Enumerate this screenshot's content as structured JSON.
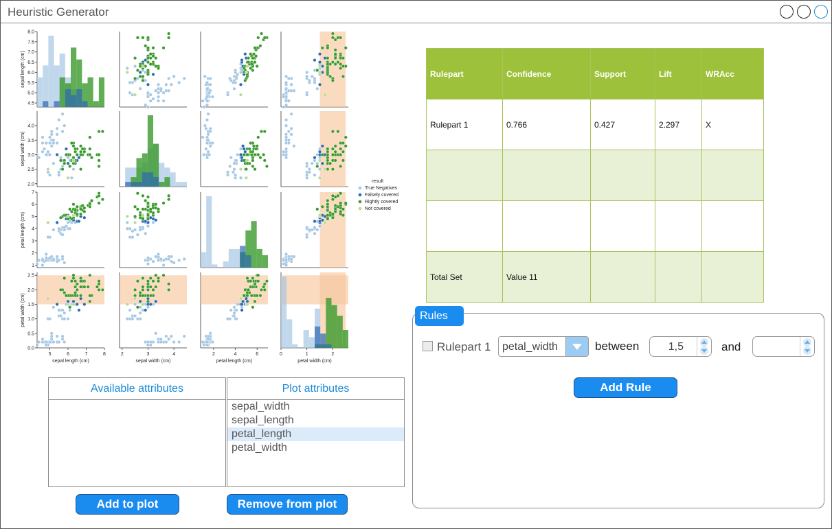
{
  "window": {
    "title": "Heuristic Generator"
  },
  "chart_data": {
    "type": "scatter",
    "subtype": "pairplot",
    "variables": [
      "sepal length (cm)",
      "sepal width (cm)",
      "petal length (cm)",
      "petal width (cm)"
    ],
    "axis_ranges": {
      "sepal length (cm)": [
        4.3,
        8.0
      ],
      "sepal width (cm)": [
        1.9,
        4.5
      ],
      "petal length (cm)": [
        0.8,
        7.0
      ],
      "petal width (cm)": [
        0.0,
        2.6
      ]
    },
    "y_ticks": [
      [
        "4.5",
        "5.0",
        "5.5",
        "6.0",
        "6.5",
        "7.0",
        "7.5",
        "8.0"
      ],
      [
        "2.0",
        "2.5",
        "3.0",
        "3.5",
        "4.0"
      ],
      [
        "1",
        "2",
        "3",
        "4",
        "5",
        "6",
        "7"
      ],
      [
        "0.0",
        "0.5",
        "1.0",
        "1.5",
        "2.0",
        "2.5"
      ]
    ],
    "x_ticks": [
      [
        "5",
        "6",
        "7",
        "8"
      ],
      [
        "2",
        "3",
        "4"
      ],
      [
        "2",
        "4",
        "6"
      ],
      [
        "0",
        "1",
        "2"
      ]
    ],
    "legend": {
      "title": "result",
      "placement": "right",
      "entries": [
        {
          "name": "True Negatives",
          "color": "#a6c8e4"
        },
        {
          "name": "Falsely covered",
          "color": "#2d6ab3"
        },
        {
          "name": "Rightly covered",
          "color": "#3a9a2c"
        },
        {
          "name": "Not covered",
          "color": "#b9dc8e"
        }
      ]
    },
    "highlight": {
      "variable": "petal width (cm)",
      "range": [
        1.5,
        2.5
      ],
      "color": "#f8c89e"
    },
    "series": [
      {
        "name": "True Negatives",
        "points": [
          [
            4.9,
            3.0,
            1.4,
            0.2
          ],
          [
            5.1,
            3.5,
            1.4,
            0.2
          ],
          [
            4.7,
            3.2,
            1.3,
            0.2
          ],
          [
            4.6,
            3.1,
            1.5,
            0.2
          ],
          [
            5.0,
            3.6,
            1.4,
            0.2
          ],
          [
            5.4,
            3.9,
            1.7,
            0.4
          ],
          [
            4.6,
            3.4,
            1.4,
            0.3
          ],
          [
            5.0,
            3.4,
            1.5,
            0.2
          ],
          [
            4.4,
            2.9,
            1.4,
            0.2
          ],
          [
            4.9,
            3.1,
            1.5,
            0.1
          ],
          [
            5.4,
            3.7,
            1.5,
            0.2
          ],
          [
            4.8,
            3.4,
            1.6,
            0.2
          ],
          [
            4.8,
            3.0,
            1.4,
            0.1
          ],
          [
            4.3,
            3.0,
            1.1,
            0.1
          ],
          [
            5.8,
            4.0,
            1.2,
            0.2
          ],
          [
            5.7,
            4.4,
            1.5,
            0.4
          ],
          [
            5.4,
            3.9,
            1.3,
            0.4
          ],
          [
            5.1,
            3.5,
            1.4,
            0.3
          ],
          [
            5.7,
            3.8,
            1.7,
            0.3
          ],
          [
            5.1,
            3.8,
            1.5,
            0.3
          ],
          [
            5.4,
            3.4,
            1.7,
            0.2
          ],
          [
            5.1,
            3.7,
            1.5,
            0.4
          ],
          [
            4.6,
            3.6,
            1.0,
            0.2
          ],
          [
            5.1,
            3.3,
            1.7,
            0.5
          ],
          [
            4.8,
            3.4,
            1.9,
            0.2
          ],
          [
            5.0,
            3.0,
            1.6,
            0.2
          ],
          [
            5.2,
            3.5,
            1.5,
            0.2
          ],
          [
            5.2,
            3.4,
            1.4,
            0.2
          ],
          [
            5.5,
            4.2,
            1.4,
            0.2
          ],
          [
            5.0,
            2.3,
            3.3,
            1.0
          ],
          [
            5.6,
            2.9,
            3.6,
            1.3
          ],
          [
            5.5,
            2.4,
            3.8,
            1.1
          ],
          [
            5.7,
            2.6,
            3.5,
            1.0
          ],
          [
            6.0,
            2.2,
            4.0,
            1.0
          ],
          [
            5.8,
            2.7,
            3.9,
            1.2
          ],
          [
            6.1,
            2.8,
            4.0,
            1.3
          ],
          [
            5.6,
            2.5,
            3.9,
            1.1
          ],
          [
            5.9,
            3.0,
            4.2,
            1.5
          ],
          [
            6.2,
            2.2,
            4.5,
            1.5
          ],
          [
            5.5,
            2.3,
            4.0,
            1.3
          ],
          [
            5.7,
            2.8,
            4.1,
            1.3
          ],
          [
            6.3,
            2.5,
            4.9,
            1.5
          ],
          [
            6.4,
            3.2,
            4.5,
            1.5
          ],
          [
            6.0,
            2.9,
            4.5,
            1.5
          ],
          [
            5.8,
            2.7,
            4.1,
            1.0
          ],
          [
            6.1,
            3.0,
            4.6,
            1.4
          ],
          [
            4.9,
            2.4,
            3.3,
            1.0
          ],
          [
            5.2,
            2.7,
            3.9,
            1.4
          ]
        ]
      },
      {
        "name": "Falsely covered",
        "points": [
          [
            5.9,
            3.2,
            4.8,
            1.8
          ],
          [
            6.3,
            3.3,
            4.7,
            1.6
          ],
          [
            6.0,
            2.7,
            5.1,
            1.6
          ],
          [
            6.7,
            3.0,
            5.0,
            1.7
          ],
          [
            5.4,
            3.0,
            4.5,
            1.5
          ],
          [
            6.9,
            3.1,
            4.9,
            1.5
          ],
          [
            6.5,
            2.8,
            4.6,
            1.5
          ],
          [
            6.6,
            2.9,
            4.6,
            1.3
          ]
        ]
      },
      {
        "name": "Rightly covered",
        "points": [
          [
            6.3,
            3.3,
            6.0,
            2.5
          ],
          [
            5.8,
            2.7,
            5.1,
            1.9
          ],
          [
            7.1,
            3.0,
            5.9,
            2.1
          ],
          [
            6.3,
            2.9,
            5.6,
            1.8
          ],
          [
            6.5,
            3.0,
            5.8,
            2.2
          ],
          [
            7.6,
            3.0,
            6.6,
            2.1
          ],
          [
            7.3,
            2.9,
            6.3,
            1.8
          ],
          [
            6.7,
            2.5,
            5.8,
            1.8
          ],
          [
            7.2,
            3.6,
            6.1,
            2.5
          ],
          [
            6.5,
            3.2,
            5.1,
            2.0
          ],
          [
            6.4,
            2.7,
            5.3,
            1.9
          ],
          [
            6.8,
            3.0,
            5.5,
            2.1
          ],
          [
            5.7,
            2.5,
            5.0,
            2.0
          ],
          [
            5.8,
            2.8,
            5.1,
            2.4
          ],
          [
            6.4,
            3.2,
            5.3,
            2.3
          ],
          [
            6.5,
            3.0,
            5.5,
            1.8
          ],
          [
            7.7,
            3.8,
            6.7,
            2.2
          ],
          [
            7.7,
            2.6,
            6.9,
            2.3
          ],
          [
            6.9,
            3.2,
            5.7,
            2.3
          ],
          [
            5.6,
            2.8,
            4.9,
            2.0
          ],
          [
            7.7,
            2.8,
            6.7,
            2.0
          ],
          [
            6.3,
            2.7,
            4.9,
            1.8
          ],
          [
            6.7,
            3.3,
            5.7,
            2.1
          ],
          [
            7.2,
            3.2,
            6.0,
            1.8
          ],
          [
            6.2,
            2.8,
            4.8,
            1.8
          ],
          [
            6.1,
            3.0,
            4.9,
            1.8
          ],
          [
            6.4,
            2.8,
            5.6,
            2.1
          ],
          [
            7.2,
            3.0,
            5.8,
            1.6
          ],
          [
            7.9,
            3.8,
            6.4,
            2.0
          ],
          [
            6.3,
            3.4,
            5.6,
            2.4
          ],
          [
            6.4,
            3.1,
            5.5,
            1.8
          ],
          [
            6.0,
            3.0,
            4.8,
            1.8
          ],
          [
            6.9,
            3.1,
            5.4,
            2.1
          ],
          [
            6.7,
            3.1,
            5.6,
            2.4
          ],
          [
            5.8,
            2.7,
            5.1,
            1.9
          ],
          [
            6.8,
            3.2,
            5.9,
            2.3
          ],
          [
            6.7,
            3.0,
            5.2,
            2.3
          ],
          [
            6.5,
            3.0,
            5.2,
            2.0
          ],
          [
            6.2,
            3.4,
            5.4,
            2.3
          ],
          [
            5.9,
            3.0,
            5.1,
            1.8
          ],
          [
            6.1,
            2.6,
            5.6,
            1.4
          ],
          [
            7.7,
            3.0,
            6.1,
            2.3
          ]
        ]
      },
      {
        "name": "Not covered",
        "points": [
          [
            4.9,
            2.5,
            4.5,
            1.7
          ],
          [
            6.0,
            2.2,
            5.0,
            1.5
          ],
          [
            6.3,
            2.8,
            5.1,
            1.5
          ]
        ]
      }
    ]
  },
  "lists": {
    "available": {
      "header": "Available attributes",
      "items": []
    },
    "plot": {
      "header": "Plot attributes",
      "items": [
        "sepal_width",
        "sepal_length",
        "petal_length",
        "petal_width"
      ]
    }
  },
  "buttons": {
    "add_to_plot": "Add to plot",
    "remove_from_plot": "Remove from plot",
    "add_rule": "Add Rule"
  },
  "table": {
    "headers": [
      "Rulepart",
      "Confidence",
      "Support",
      "Lift",
      "WRAcc"
    ],
    "rows": [
      [
        "Rulepart 1",
        "0.766",
        "0.427",
        "2.297",
        "X"
      ],
      [
        "",
        "",
        "",
        "",
        ""
      ],
      [
        "",
        "",
        "",
        "",
        ""
      ],
      [
        "Total Set",
        "Value 11",
        "",
        "",
        ""
      ]
    ]
  },
  "rules": {
    "tab_label": "Rules",
    "rulepart_label": "Rulepart 1",
    "attribute_value": "petal_width",
    "between_label": "between",
    "lower_value": "1,5",
    "and_label": "and",
    "upper_value": ""
  }
}
